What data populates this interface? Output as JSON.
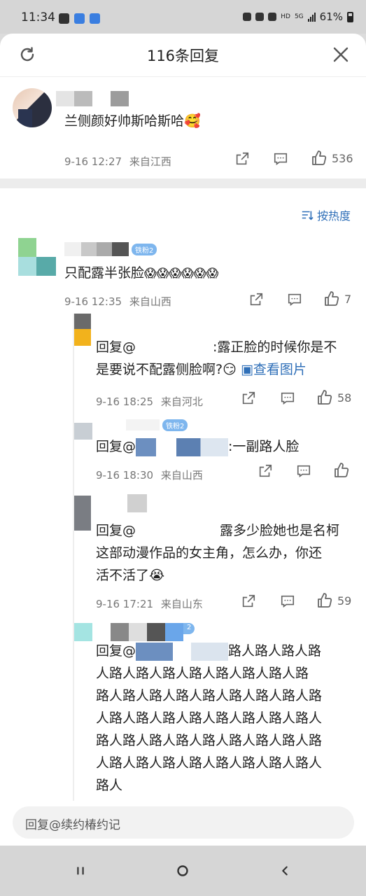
{
  "status_bar": {
    "time": "11:34",
    "network": "5G",
    "hd": "HD",
    "battery": "61%"
  },
  "header": {
    "title": "116条回复"
  },
  "main_comment": {
    "text": "兰侧颜好帅斯哈斯哈",
    "emoji": "🥰",
    "time": "9-16 12:27",
    "location": "来自江西",
    "likes": "536"
  },
  "sort": {
    "label": "按热度"
  },
  "replies": [
    {
      "text": "只配露半张脸",
      "emojis": "😱😱😱😱😱😱",
      "badge": "铁粉2",
      "time": "9-16 12:35",
      "location": "来自山西",
      "likes": "7"
    }
  ],
  "sub_replies": [
    {
      "prefix": "回复@",
      "text": ":露正脸的时候你是不",
      "text2": "是要说不配露侧脸啊?",
      "emoji": "😏",
      "image_link": "查看图片",
      "time": "9-16 18:25",
      "location": "来自河北",
      "likes": "58"
    },
    {
      "prefix": "回复@",
      "badge": "铁粉2",
      "text": ":一副路人脸",
      "time": "9-16 18:30",
      "location": "来自山西",
      "likes": ""
    },
    {
      "prefix": "回复@",
      "text": "露多少脸她也是名柯",
      "text2": "这部动漫作品的女主角，怎么办，你还",
      "text3": "活不活了",
      "emoji": "😭",
      "time": "9-16 17:21",
      "location": "来自山东",
      "likes": "59"
    },
    {
      "prefix": "回复@",
      "badge": "2",
      "line1": "路人路人路人路",
      "line2": "人路人路人路人路人路人路人路人路",
      "line3": "路人路人路人路人路人路人路人路人路",
      "line4": "人路人路人路人路人路人路人路人路人",
      "line5": "路人路人路人路人路人路人路人路人路",
      "line6": "人路人路人路人路人路人路人路人路人",
      "line7": "路人"
    }
  ],
  "reply_input": {
    "placeholder": "回复@续约椿约记"
  }
}
